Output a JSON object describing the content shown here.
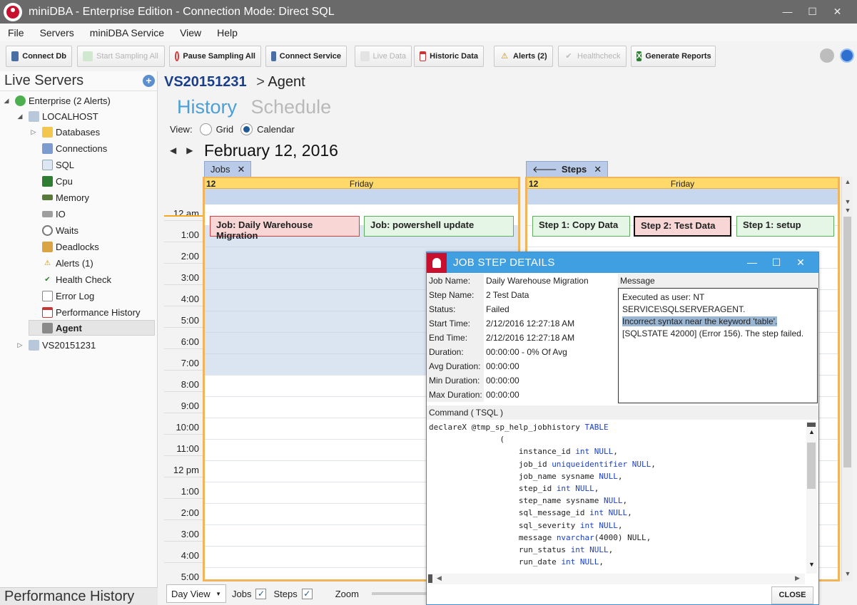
{
  "window": {
    "title": "miniDBA - Enterprise Edition - Connection Mode: Direct SQL",
    "min": "—",
    "max": "☐",
    "close": "✕"
  },
  "menu": [
    "File",
    "Servers",
    "miniDBA Service",
    "View",
    "Help"
  ],
  "toolbar": {
    "connect_db": "Connect Db",
    "start_sampling": "Start Sampling All",
    "pause_sampling": "Pause Sampling All",
    "connect_service": "Connect Service",
    "live_data": "Live Data",
    "historic_data": "Historic Data",
    "alerts": "Alerts (2)",
    "healthcheck": "Healthcheck",
    "generate_reports": "Generate Reports"
  },
  "left_panel": {
    "title": "Live Servers",
    "footer": "Performance History",
    "tree": {
      "enterprise": "Enterprise (2 Alerts)",
      "localhost": "LOCALHOST",
      "databases": "Databases",
      "connections": "Connections",
      "sql": "SQL",
      "cpu": "Cpu",
      "memory": "Memory",
      "io": "IO",
      "waits": "Waits",
      "deadlocks": "Deadlocks",
      "alerts": "Alerts (1)",
      "health_check": "Health Check",
      "error_log": "Error Log",
      "performance_history": "Performance History",
      "agent": "Agent",
      "vs_server": "VS20151231"
    }
  },
  "main": {
    "breadcrumb_server": "VS20151231",
    "breadcrumb_sep": ">",
    "breadcrumb_page": "Agent",
    "tab_history": "History",
    "tab_schedule": "Schedule",
    "view_label": "View:",
    "view_grid": "Grid",
    "view_calendar": "Calendar",
    "date_title": "February 12, 2016"
  },
  "calendar": {
    "times": [
      "12 am",
      "1:00",
      "2:00",
      "3:00",
      "4:00",
      "5:00",
      "6:00",
      "7:00",
      "8:00",
      "9:00",
      "10:00",
      "11:00",
      "12 pm",
      "1:00",
      "2:00",
      "3:00",
      "4:00",
      "5:00"
    ],
    "jobs_tab": "Jobs",
    "steps_tab": "Steps",
    "day_num": "12",
    "day_name": "Friday",
    "jobs": [
      "Job: Daily Warehouse Migration",
      "Job: powershell update"
    ],
    "steps": [
      "Step 1: Copy Data",
      "Step 2: Test Data",
      "Step 1: setup"
    ]
  },
  "bottom": {
    "day_view": "Day View",
    "jobs_label": "Jobs",
    "steps_label": "Steps",
    "zoom_label": "Zoom",
    "check": "✓"
  },
  "dialog": {
    "title": "JOB STEP DETAILS",
    "props": [
      {
        "label": "Job Name:",
        "value": "Daily Warehouse Migration"
      },
      {
        "label": "Step Name:",
        "value": "2 Test Data"
      },
      {
        "label": "Status:",
        "value": "Failed"
      },
      {
        "label": "Start Time:",
        "value": "2/12/2016 12:27:18 AM"
      },
      {
        "label": "End Time:",
        "value": "2/12/2016 12:27:18 AM"
      },
      {
        "label": "Duration:",
        "value": "00:00:00 - 0% Of Avg"
      },
      {
        "label": "Avg Duration:",
        "value": "00:00:00"
      },
      {
        "label": "Min Duration:",
        "value": "00:00:00"
      },
      {
        "label": "Max Duration:",
        "value": "00:00:00"
      }
    ],
    "message_header": "Message",
    "message_line1": "Executed as user: NT SERVICE\\SQLSERVERAGENT.",
    "message_highlight": "Incorrect syntax near the keyword 'table'.",
    "message_line3": "[SQLSTATE 42000] (Error 156).  The step failed.",
    "command_header": "Command ( TSQL )",
    "code_lines": [
      {
        "t": "declareX @tmp_sp_help_jobhistory ",
        "k": "TABLE",
        "r": ""
      },
      {
        "t": "               (",
        "k": "",
        "r": ""
      },
      {
        "t": "                   instance_id ",
        "k": "int NULL",
        "r": ","
      },
      {
        "t": "                   job_id ",
        "k": "uniqueidentifier NULL",
        "r": ","
      },
      {
        "t": "                   job_name sysname ",
        "k": "NULL",
        "r": ","
      },
      {
        "t": "                   step_id ",
        "k": "int NULL",
        "r": ","
      },
      {
        "t": "                   step_name sysname ",
        "k": "NULL",
        "r": ","
      },
      {
        "t": "                   sql_message_id ",
        "k": "int NULL",
        "r": ","
      },
      {
        "t": "                   sql_severity ",
        "k": "int NULL",
        "r": ","
      },
      {
        "t": "                   message ",
        "k": "nvarchar",
        "r": "(4000) NULL,"
      },
      {
        "t": "                   run_status ",
        "k": "int NULL",
        "r": ","
      },
      {
        "t": "                   run_date ",
        "k": "int NULL",
        "r": ","
      }
    ],
    "close_label": "CLOSE"
  }
}
